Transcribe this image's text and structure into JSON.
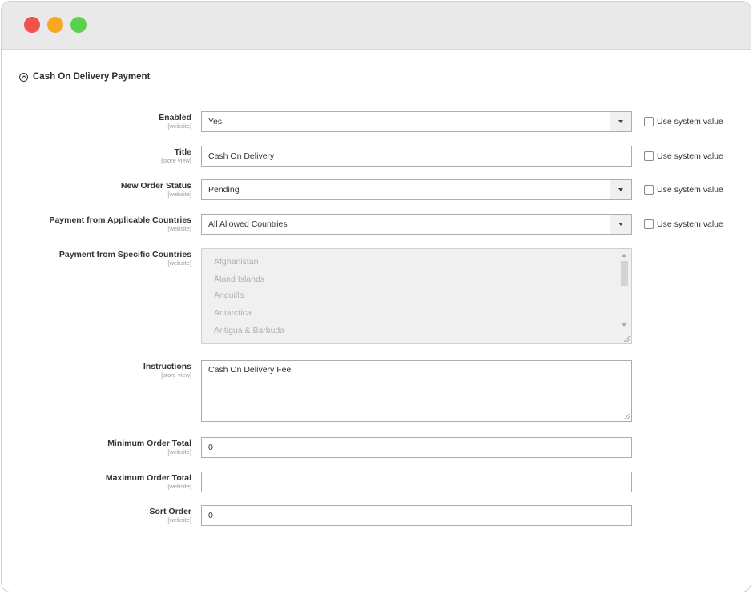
{
  "section": {
    "title": "Cash On Delivery Payment",
    "icon": "collapse-up-icon"
  },
  "fields": {
    "enabled": {
      "label": "Enabled",
      "scope": "[website]",
      "value": "Yes",
      "use_system": "Use system value"
    },
    "title": {
      "label": "Title",
      "scope": "[store view]",
      "value": "Cash On Delivery",
      "use_system": "Use system value"
    },
    "new_order_status": {
      "label": "New Order Status",
      "scope": "[website]",
      "value": "Pending",
      "use_system": "Use system value"
    },
    "applicable_countries": {
      "label": "Payment from Applicable Countries",
      "scope": "[website]",
      "value": "All Allowed Countries",
      "use_system": "Use system value"
    },
    "specific_countries": {
      "label": "Payment from Specific Countries",
      "scope": "[website]",
      "options": [
        "Afghanistan",
        "Åland Islands",
        "Anguilla",
        "Antarctica",
        "Antigua & Barbuda"
      ]
    },
    "instructions": {
      "label": "Instructions",
      "scope": "[store view]",
      "value": "Cash On Delivery Fee"
    },
    "min_order_total": {
      "label": "Minimum Order Total",
      "scope": "[website]",
      "value": "0"
    },
    "max_order_total": {
      "label": "Maximum Order Total",
      "scope": "[website]",
      "value": ""
    },
    "sort_order": {
      "label": "Sort Order",
      "scope": "[website]",
      "value": "0"
    }
  },
  "colors": {
    "close": "#f1534b",
    "minimize": "#f7a823",
    "maximize": "#5ad04c"
  }
}
